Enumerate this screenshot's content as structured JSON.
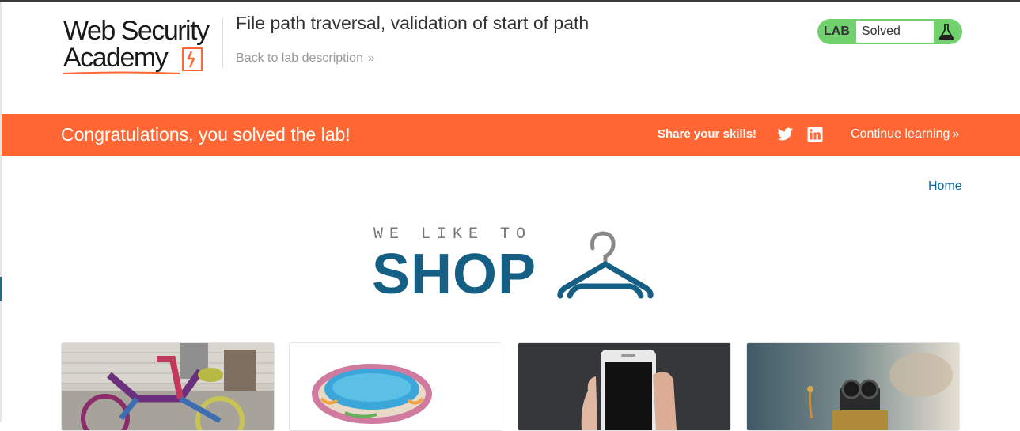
{
  "header": {
    "logo_line1": "Web Security",
    "logo_line2": "Academy",
    "lab_title": "File path traversal, validation of start of path",
    "back_link": "Back to lab description",
    "back_link_icon": "double-chevron-right-icon"
  },
  "lab_status": {
    "tag": "LAB",
    "status": "Solved",
    "icon": "flask-icon",
    "color": "#70d16d"
  },
  "banner": {
    "message": "Congratulations, you solved the lab!",
    "share_label": "Share your skills!",
    "share_icons": [
      "twitter-icon",
      "linkedin-icon"
    ],
    "continue_label": "Continue learning",
    "color": "#ff6633"
  },
  "nav": {
    "home_link": "Home"
  },
  "shop_logo": {
    "tagline": "WE LIKE TO",
    "word": "SHOP",
    "icon": "hanger-icon",
    "color": "#155f84"
  },
  "products": [
    {
      "image": "knitted-bicycle-image"
    },
    {
      "image": "paddling-pool-image"
    },
    {
      "image": "smartphone-in-hand-image"
    },
    {
      "image": "robot-figure-image"
    }
  ]
}
